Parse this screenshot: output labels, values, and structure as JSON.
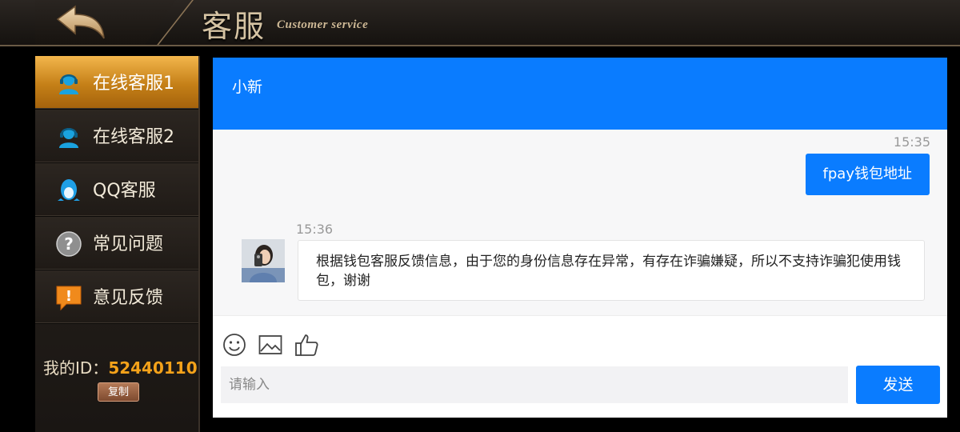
{
  "header": {
    "title_cn": "客服",
    "title_en": "Customer service",
    "back_icon": "back-arrow-icon"
  },
  "sidebar": {
    "items": [
      {
        "label": "在线客服1",
        "icon": "agent-headset-icon",
        "active": true
      },
      {
        "label": "在线客服2",
        "icon": "agent-headset-icon",
        "active": false
      },
      {
        "label": "QQ客服",
        "icon": "qq-penguin-icon",
        "active": false
      },
      {
        "label": "常见问题",
        "icon": "question-icon",
        "active": false
      },
      {
        "label": "意见反馈",
        "icon": "feedback-icon",
        "active": false
      }
    ],
    "my_id_label": "我的ID：",
    "my_id_value": "52440110",
    "copy_label": "复制"
  },
  "chat": {
    "agent_name": "小新",
    "messages": [
      {
        "time": "15:35",
        "from": "user",
        "text": "fpay钱包地址"
      },
      {
        "time": "15:36",
        "from": "agent",
        "text": "根据钱包客服反馈信息，由于您的身份信息存在异常，有存在诈骗嫌疑，所以不支持诈骗犯使用钱包，谢谢"
      }
    ],
    "toolbar_icons": [
      "emoji-icon",
      "image-icon",
      "thumbs-up-icon"
    ],
    "input_placeholder": "请输入",
    "send_label": "发送"
  },
  "colors": {
    "accent_blue": "#0a7cff",
    "active_orange": "#e09a2a",
    "id_orange": "#f4a21a"
  }
}
